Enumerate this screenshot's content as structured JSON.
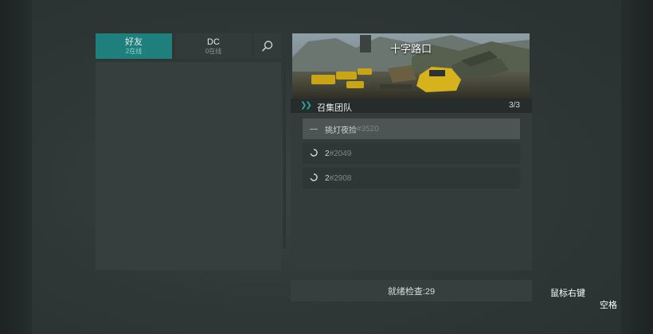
{
  "tabs": {
    "friends": {
      "label": "好友",
      "sub": "2在线"
    },
    "dc": {
      "label": "DC",
      "sub": "0在线"
    },
    "search_icon": "search-icon"
  },
  "map": {
    "title": "十字路口"
  },
  "squad": {
    "label": "召集团队",
    "count": "3/3",
    "members": [
      {
        "status_icon": "dash-icon",
        "name": "挑灯夜捡",
        "tag": "#3520"
      },
      {
        "status_icon": "loading-icon",
        "name": "2",
        "tag": "#2049"
      },
      {
        "status_icon": "loading-icon",
        "name": "2",
        "tag": "#2908"
      }
    ]
  },
  "ready_check": {
    "label": "就绪检查:29"
  },
  "hints": {
    "right_click": "鼠标右键",
    "space": "空格"
  },
  "colors": {
    "accent": "#1f7f7d",
    "panel": "#373e3e"
  }
}
